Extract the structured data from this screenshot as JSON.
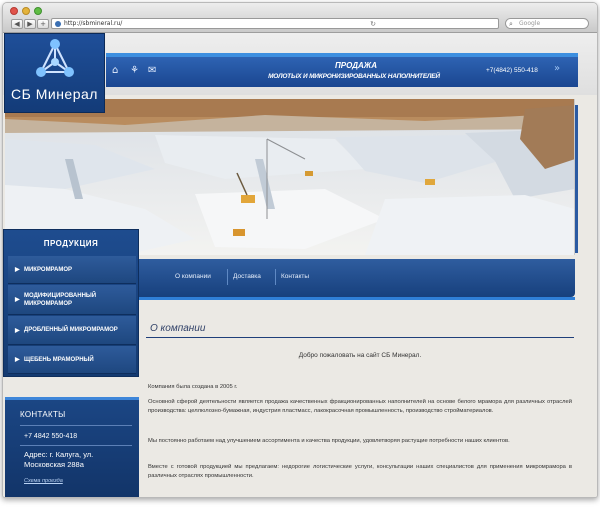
{
  "browser": {
    "url": "http://sbmineral.ru/",
    "search_placeholder": "Google"
  },
  "site": {
    "logo_text": "СБ Минерал",
    "slogan_line1": "ПРОДАЖА",
    "slogan_line2": "МОЛОТЫХ И МИКРОНИЗИРОВАННЫХ НАПОЛНИТЕЛЕЙ",
    "phone_header": "+7(4842) 550-418"
  },
  "nav": {
    "items": [
      "О компании",
      "Доставка",
      "Контакты"
    ]
  },
  "sidebar": {
    "title": "ПРОДУКЦИЯ",
    "items": [
      "МИКРОМРАМОР",
      "МОДИФИЦИРОВАННЫЙ МИКРОМРАМОР",
      "ДРОБЛЕННЫЙ МИКРОМРАМОР",
      "ЩЕБЕНЬ МРАМОРНЫЙ"
    ]
  },
  "contacts": {
    "title": "КОНТАКТЫ",
    "phone": "+7 4842 550-418",
    "address": "Адрес: г. Калуга, ул. Московская 288а",
    "route_link": "Схема проезда"
  },
  "content": {
    "heading": "О компании",
    "welcome": "Добро пожаловать на сайт СБ Минерал.",
    "paragraphs": [
      "Компания была создана в 2005 г.",
      "Основной сферой деятельности является продажа качественных фракционированных наполнителей на основе белого мрамора для различных отраслей производства: целлюлозно-бумажная, индустрия пластмасс, лакокрасочная промышленность, производство стройматериалов.",
      "Мы постоянно работаем над улучшением ассортимента и качества продукции, удовлетворяя растущие потребности наших клиентов.",
      "Вместе с готовой продукцией мы предлагаем: недорогие логистические услуги, консультации наших специалистов для применения микромрамора в различных отраслях промышленности."
    ]
  },
  "colors": {
    "brand_blue": "#1f4f99",
    "accent_blue": "#3d8fe0",
    "page_bg": "#ebe9e4"
  }
}
